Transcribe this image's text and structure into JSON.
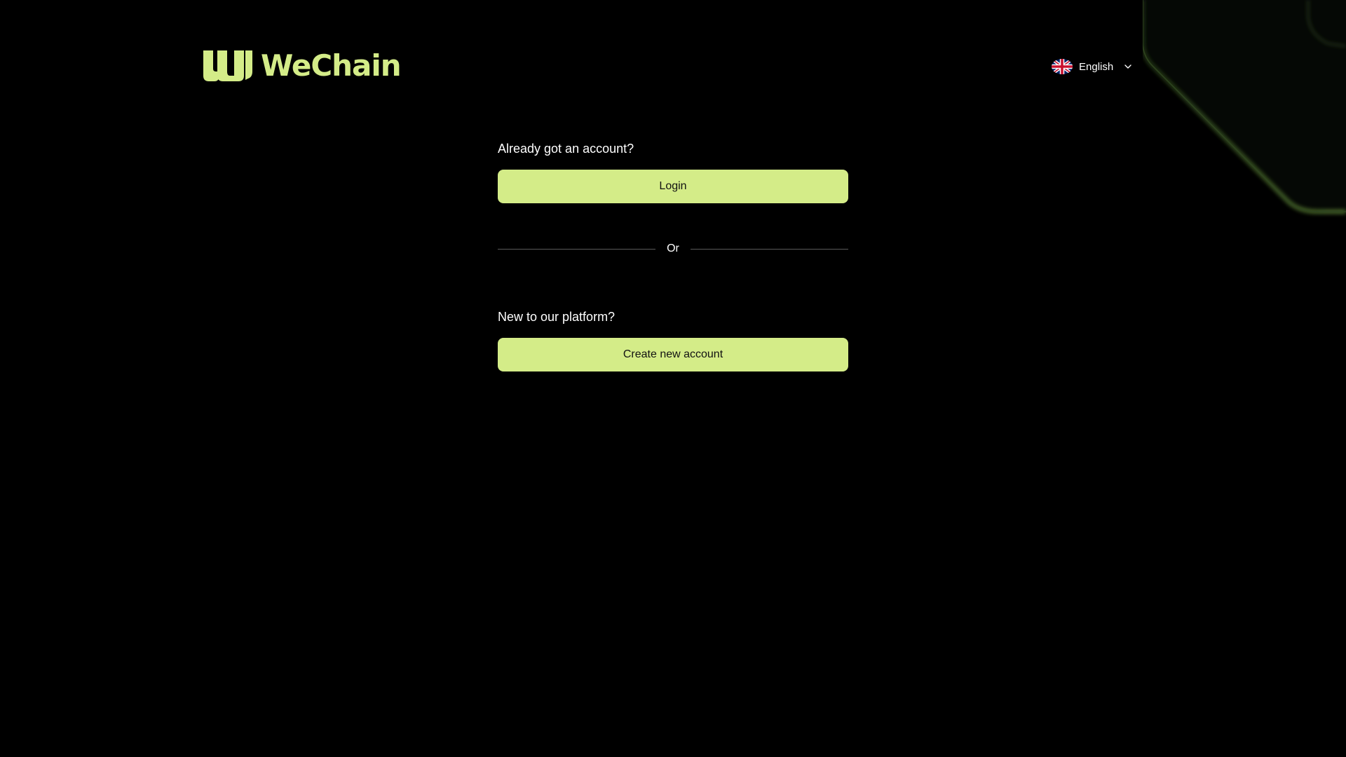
{
  "brand": {
    "name": "WeChain",
    "accent_color": "#d4ec88",
    "logo_icon": "wechain-logo-icon"
  },
  "language": {
    "selected": "English",
    "flag_icon": "uk-flag-icon",
    "dropdown_icon": "chevron-down-icon"
  },
  "login_section": {
    "prompt": "Already got an account?",
    "button_label": "Login"
  },
  "divider": {
    "label": "Or"
  },
  "signup_section": {
    "prompt": "New to our platform?",
    "button_label": "Create new account"
  }
}
